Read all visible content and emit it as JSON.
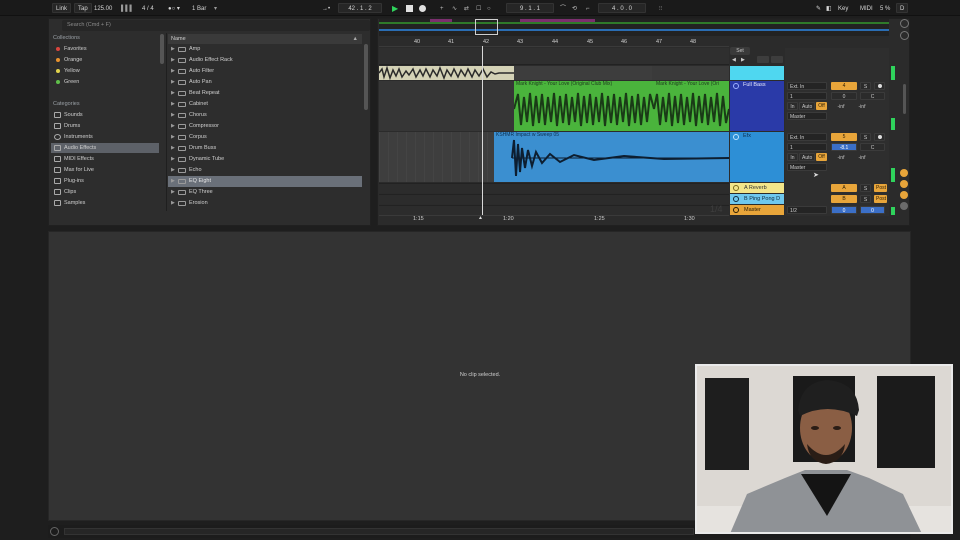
{
  "transport": {
    "link": "Link",
    "tap": "Tap",
    "tempo": "125.00",
    "time_signature": "4 / 4",
    "quantization": "1 Bar",
    "position": "42 .  1 .  2",
    "loop_start": "9 .  1 .  1",
    "loop_length": "4 .  0 .  0",
    "key": "Key",
    "midi": "MIDI",
    "cpu": "5 %",
    "disk": "D"
  },
  "browser": {
    "search_placeholder": "Search (Cmd + F)",
    "collections_title": "Collections",
    "collections": [
      {
        "label": "Favorites",
        "color": "#d9453d"
      },
      {
        "label": "Orange",
        "color": "#e8922f"
      },
      {
        "label": "Yellow",
        "color": "#e2d34c"
      },
      {
        "label": "Green",
        "color": "#5fbf4a"
      }
    ],
    "categories_title": "Categories",
    "categories": [
      "Sounds",
      "Drums",
      "Instruments",
      "Audio Effects",
      "MIDI Effects",
      "Max for Live",
      "Plug-ins",
      "Clips",
      "Samples"
    ],
    "selected_category": "Audio Effects",
    "name_header": "Name",
    "items": [
      "Amp",
      "Audio Effect Rack",
      "Auto Filter",
      "Auto Pan",
      "Beat Repeat",
      "Cabinet",
      "Chorus",
      "Compressor",
      "Corpus",
      "Drum Buss",
      "Dynamic Tube",
      "Echo",
      "EQ Eight",
      "EQ Three",
      "Erosion"
    ],
    "selected_item": "EQ Eight"
  },
  "arrangement": {
    "bars": [
      "40",
      "41",
      "42",
      "43",
      "44",
      "45",
      "46",
      "47",
      "48"
    ],
    "times": [
      "1:15",
      "1:20",
      "1:25",
      "1:30"
    ],
    "zoom_label": "1/4",
    "set_label": "Set",
    "clips": {
      "green_a": "Mark Knight - Your Love (Original Club Mix)",
      "green_b": "Mark Knight - Your Love (Ori",
      "blue": "KSHMR Impact w Sweep 05"
    },
    "tracks": [
      {
        "name": "Full Bass",
        "color": "#2a3aa8",
        "input": "Ext. In",
        "channel": "1",
        "monitor_in": "In",
        "monitor_auto": "Auto",
        "monitor_off": "Off",
        "output": "Master",
        "number": "4",
        "solo": "S",
        "volume": "0",
        "pan": "C",
        "send_a": "-inf",
        "send_b": "-inf"
      },
      {
        "name": "Efx",
        "color": "#2d8fd6",
        "input": "Ext. In",
        "channel": "1",
        "monitor_in": "In",
        "monitor_auto": "Auto",
        "monitor_off": "Off",
        "output": "Master",
        "number": "5",
        "solo": "S",
        "volume": "-8.1",
        "pan": "C",
        "send_a": "-inf",
        "send_b": "-inf"
      }
    ],
    "returns": [
      {
        "name": "A Reverb",
        "color": "#f2e58a",
        "number": "A",
        "solo": "S",
        "post": "Post"
      },
      {
        "name": "B Ping Pong D",
        "color": "#6fc8ee",
        "number": "B",
        "solo": "S",
        "post": "Post"
      }
    ],
    "master": {
      "name": "Master",
      "color": "#e8a53a",
      "cue": "1/2",
      "volume": "0",
      "pan": "0"
    },
    "top_color": "#4fd7f0"
  },
  "detail": {
    "message": "No clip selected."
  }
}
